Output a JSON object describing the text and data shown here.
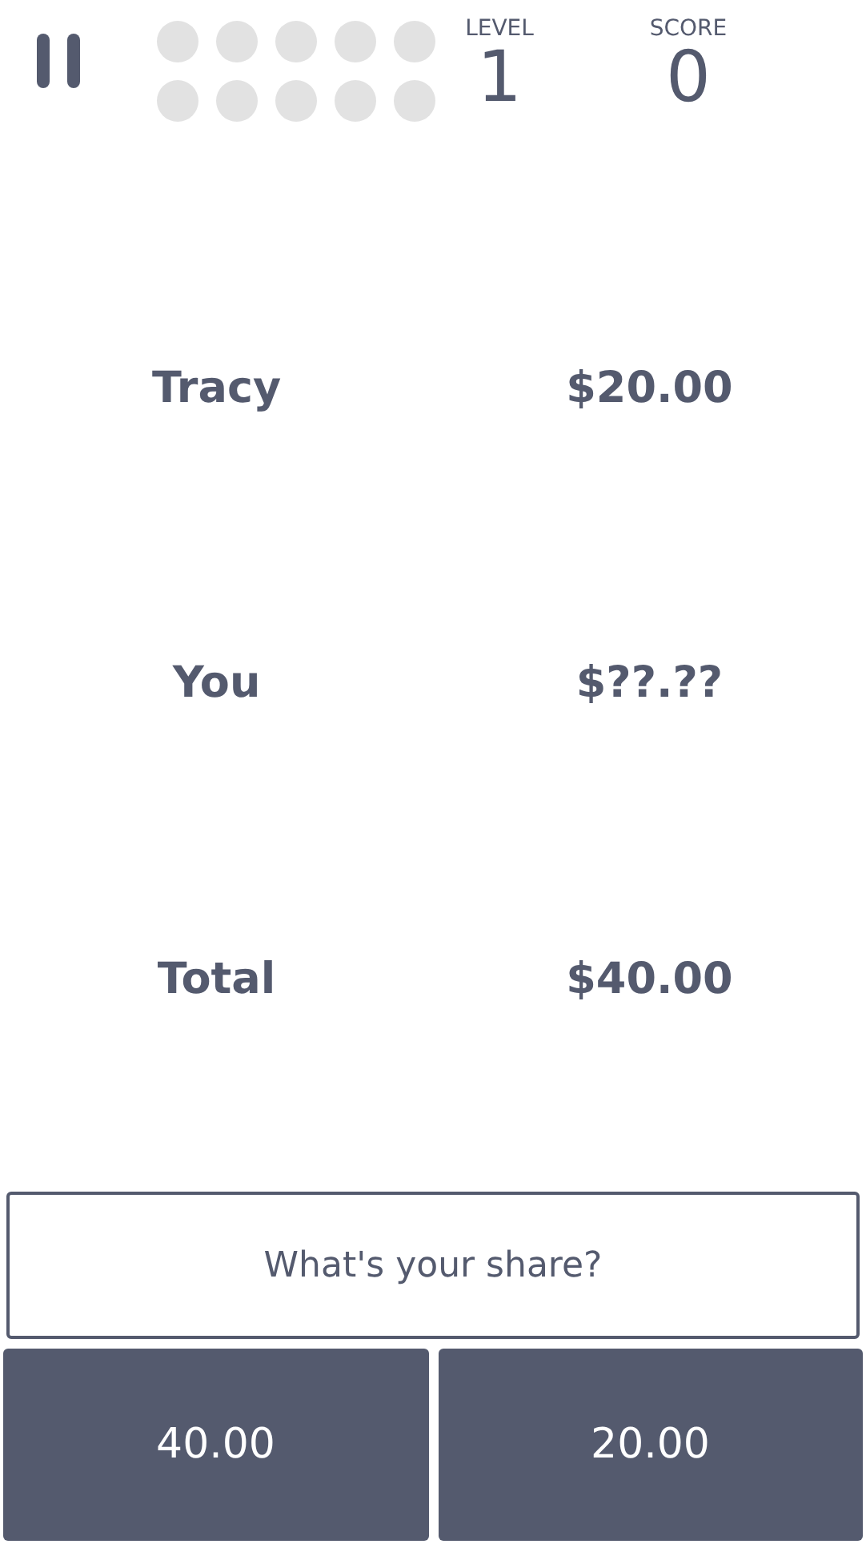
{
  "progress": [
    {
      "filled": false
    },
    {
      "filled": false
    },
    {
      "filled": false
    },
    {
      "filled": false
    },
    {
      "filled": false
    },
    {
      "filled": false
    },
    {
      "filled": false
    },
    {
      "filled": false
    },
    {
      "filled": false
    },
    {
      "filled": false
    }
  ],
  "level": {
    "label": "LEVEL",
    "value": "1"
  },
  "score": {
    "label": "SCORE",
    "value": "0"
  },
  "rows": [
    {
      "name": "Tracy",
      "amount": "$20.00"
    },
    {
      "name": "You",
      "amount": "$??.??"
    },
    {
      "name": "Total",
      "amount": "$40.00"
    }
  ],
  "prompt": "What's your share?",
  "answers": [
    "40.00",
    "20.00"
  ]
}
